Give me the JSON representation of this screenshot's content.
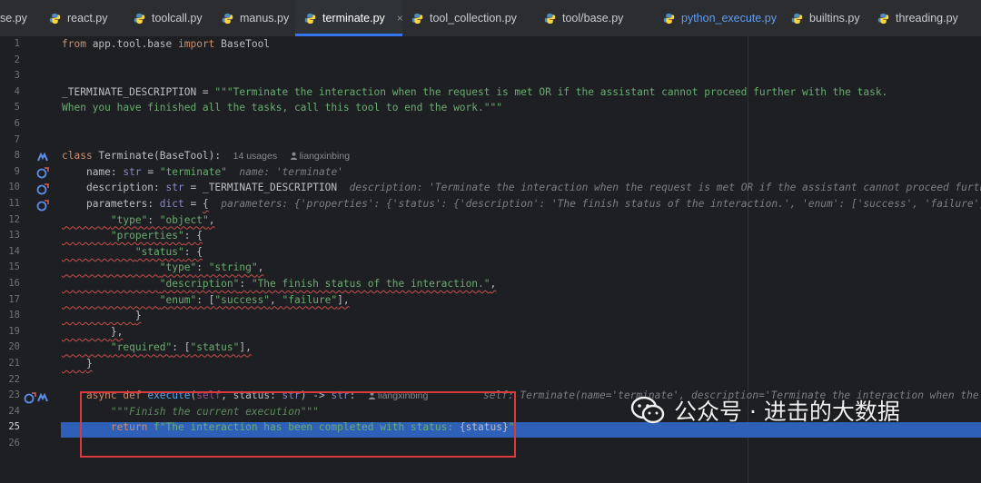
{
  "tabs": [
    {
      "label": "se.py",
      "active": false,
      "modified": false
    },
    {
      "label": "react.py",
      "active": false,
      "modified": false
    },
    {
      "label": "toolcall.py",
      "active": false,
      "modified": false
    },
    {
      "label": "manus.py",
      "active": false,
      "modified": false
    },
    {
      "label": "terminate.py",
      "active": true,
      "modified": false,
      "close": "×"
    },
    {
      "label": "tool_collection.py",
      "active": false,
      "modified": false
    },
    {
      "label": "tool/base.py",
      "active": false,
      "modified": false
    },
    {
      "label": "python_execute.py",
      "active": false,
      "modified": true
    },
    {
      "label": "builtins.py",
      "active": false,
      "modified": false
    },
    {
      "label": "threading.py",
      "active": false,
      "modified": false
    }
  ],
  "editor": {
    "line_numbers": [
      "1",
      "2",
      "3",
      "4",
      "5",
      "6",
      "7",
      "8",
      "9",
      "10",
      "11",
      "12",
      "13",
      "14",
      "15",
      "16",
      "17",
      "18",
      "19",
      "20",
      "21",
      "22",
      "23",
      "24",
      "25",
      "26"
    ],
    "current_line": "25",
    "code": {
      "l1": {
        "kw1": "from",
        "mod": " app.tool.base ",
        "kw2": "import",
        "name": " BaseTool"
      },
      "l4": {
        "name": "_TERMINATE_DESCRIPTION = ",
        "str": "\"\"\"Terminate the interaction when the request is met OR if the assistant cannot proceed further with the task."
      },
      "l5": {
        "str": "When you have finished all the tasks, call this tool to end the work.\"\"\""
      },
      "l8": {
        "kw": "class",
        "sig": " Terminate(BaseTool):",
        "usages": "14 usages",
        "author": "liangxinbing"
      },
      "l9": {
        "indent": "    ",
        "name": "name",
        "colon": ": ",
        "type": "str",
        "eq": " = ",
        "str": "\"terminate\"",
        "inlay": "name: 'terminate'"
      },
      "l10": {
        "indent": "    ",
        "name": "description",
        "colon": ": ",
        "type": "str",
        "eq": " = _TERMINATE_DESCRIPTION",
        "inlay": "description: 'Terminate the interaction when the request is met OR if the assistant cannot proceed further with th"
      },
      "l11": {
        "indent": "    ",
        "name": "parameters",
        "colon": ": ",
        "type": "dict",
        "eq": " = ",
        "brace": "{",
        "inlay": "parameters: {'properties': {'status': {'description': 'The finish status of the interaction.', 'enum': ['success', 'failure'], 'type':"
      },
      "l12": {
        "indent": "        ",
        "key": "\"type\"",
        "colon": ": ",
        "val": "\"object\"",
        "tail": ","
      },
      "l13": {
        "indent": "        ",
        "key": "\"properties\"",
        "colon": ": ",
        "tail": "{"
      },
      "l14": {
        "indent": "            ",
        "key": "\"status\"",
        "colon": ": ",
        "tail": "{"
      },
      "l15": {
        "indent": "                ",
        "key": "\"type\"",
        "colon": ": ",
        "val": "\"string\"",
        "tail": ","
      },
      "l16": {
        "indent": "                ",
        "key": "\"description\"",
        "colon": ": ",
        "val": "\"The finish status of the interaction.\"",
        "tail": ","
      },
      "l17": {
        "indent": "                ",
        "key": "\"enum\"",
        "colon": ": [",
        "val1": "\"success\"",
        "sep": ", ",
        "val2": "\"failure\"",
        "tail": "],"
      },
      "l18": {
        "indent": "            ",
        "tail": "}"
      },
      "l19": {
        "indent": "        ",
        "tail": "},"
      },
      "l20": {
        "indent": "        ",
        "key": "\"required\"",
        "colon": ": [",
        "val": "\"status\"",
        "tail": "],"
      },
      "l21": {
        "indent": "    ",
        "tail": "}"
      },
      "l23": {
        "indent": "    ",
        "kw1": "async",
        "kw2": " def ",
        "fn": "execute",
        "p1": "(",
        "self": "self",
        "p2": ", status: ",
        "type1": "str",
        "p3": ") -> ",
        "type2": "str",
        "p4": ":",
        "author": "liangxinbing",
        "inlay": "self: Terminate(name='terminate', description='Terminate the interaction when the request is"
      },
      "l24": {
        "indent": "        ",
        "doc": "\"\"\"Finish the current execution\"\"\""
      },
      "l25": {
        "indent": "        ",
        "kw": "return",
        "str1": " f\"The interaction has been completed with status: ",
        "interp": "{status}",
        "str2": "\""
      }
    }
  },
  "watermark": {
    "text": "公众号 · 进击的大数据"
  },
  "colors": {
    "accent": "#3574f0",
    "selection": "#2f60b7",
    "highlight_box": "#d93b3b"
  }
}
